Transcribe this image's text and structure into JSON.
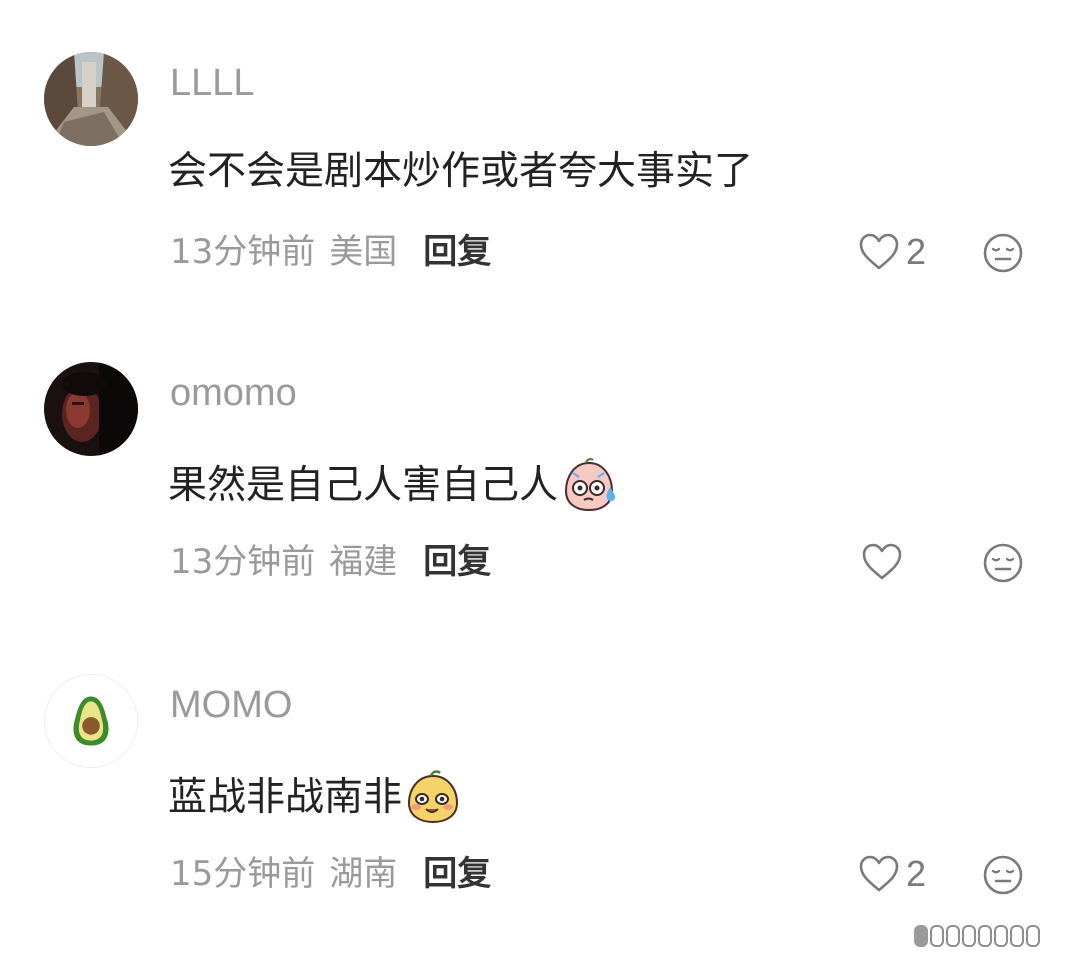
{
  "comments": [
    {
      "username": "LLLL",
      "text": "会不会是剧本炒作或者夸大事实了",
      "time": "13分钟前",
      "region": "美国",
      "reply_label": "回复",
      "likes": "2",
      "avatar_icon": "street-photo-avatar",
      "emoji_icon": null
    },
    {
      "username": "omomo",
      "text": "果然是自己人害自己人",
      "time": "13分钟前",
      "region": "福建",
      "reply_label": "回复",
      "likes": "",
      "avatar_icon": "dark-portrait-avatar",
      "emoji_icon": "sweat-face-emoji"
    },
    {
      "username": "MOMO",
      "text": "蓝战非战南非",
      "time": "15分钟前",
      "region": "湖南",
      "reply_label": "回复",
      "likes": "2",
      "avatar_icon": "avocado-avatar",
      "emoji_icon": "smug-face-emoji"
    }
  ],
  "colors": {
    "username": "#9a9a9a",
    "text": "#222222",
    "meta": "#9a9a9a",
    "reply": "#333333",
    "icon": "#7a7a7a"
  }
}
